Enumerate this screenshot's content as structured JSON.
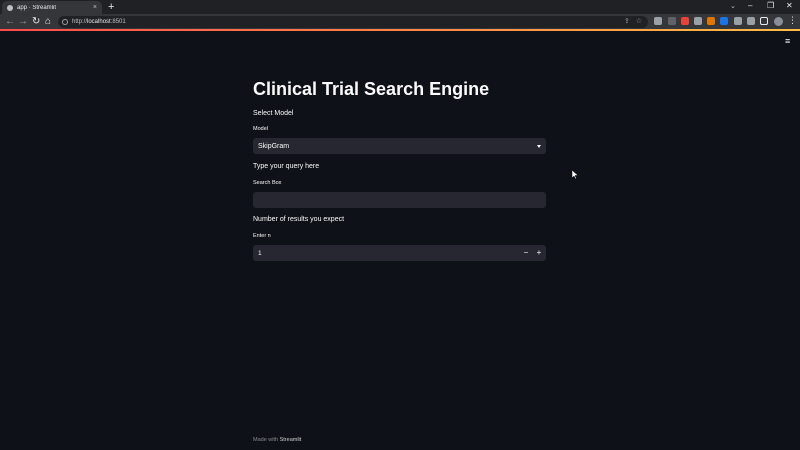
{
  "browser": {
    "tab_title": "app · Streamlit",
    "tab_close": "×",
    "new_tab": "+",
    "url_scheme": "http://",
    "url_host": "localhost",
    "url_port": ":8501",
    "window_controls": {
      "tab_search": "⌄",
      "minimize": "–",
      "maximize": "❐",
      "close": "✕"
    },
    "nav": {
      "back": "←",
      "forward": "→",
      "reload": "↻",
      "home": "⌂"
    },
    "omnibox_icons": {
      "share": "⇪",
      "bookmark": "☆"
    },
    "menu": "⋮"
  },
  "app": {
    "menu_icon": "≡",
    "title": "Clinical Trial Search Engine",
    "model_section": "Select Model",
    "model_label": "Model",
    "model_selected": "SkipGram",
    "query_section": "Type your query here",
    "query_label": "Search Box",
    "query_value": "",
    "results_section": "Number of results you expect",
    "n_label": "Enter n",
    "n_value": "1",
    "minus": "−",
    "plus": "+"
  },
  "footer": {
    "prefix": "Made with",
    "brand": "Streamlit"
  },
  "colors": {
    "background": "#0e1117",
    "widget": "#262730",
    "text": "#fafafa",
    "accent_start": "#ff4b4b",
    "accent_end": "#ffbd45"
  }
}
